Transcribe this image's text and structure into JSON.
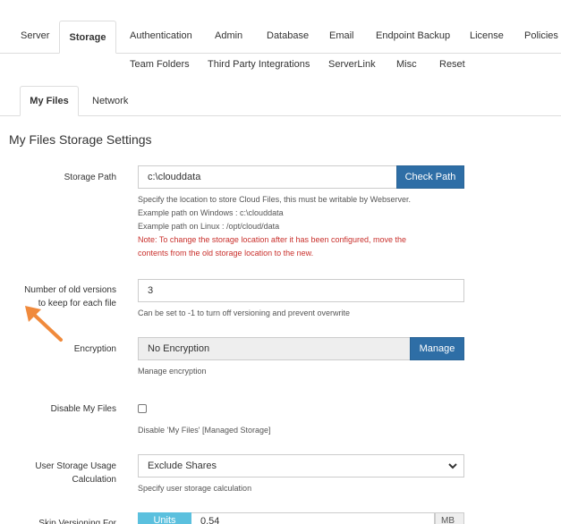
{
  "tabs_row1": [
    {
      "label": "Server"
    },
    {
      "label": "Storage"
    },
    {
      "label": "Authentication"
    },
    {
      "label": "Admin"
    },
    {
      "label": "Database"
    },
    {
      "label": "Email"
    },
    {
      "label": "Endpoint Backup"
    },
    {
      "label": "License"
    },
    {
      "label": "Policies"
    }
  ],
  "tabs_row2": [
    {
      "label": "Team Folders"
    },
    {
      "label": "Third Party Integrations"
    },
    {
      "label": "ServerLink"
    },
    {
      "label": "Misc"
    },
    {
      "label": "Reset"
    }
  ],
  "subtabs": [
    {
      "label": "My Files"
    },
    {
      "label": "Network"
    }
  ],
  "section_title": "My Files Storage Settings",
  "storage_path": {
    "label": "Storage Path",
    "value": "c:\\clouddata",
    "button": "Check Path",
    "help1": "Specify the location to store Cloud Files, this must be writable by Webserver.",
    "help2": "Example path on Windows : c:\\clouddata",
    "help3": "Example path on Linux : /opt/cloud/data",
    "note1": "Note: To change the storage location after it has been configured, move the",
    "note2": "contents from the old storage location to the new."
  },
  "old_versions": {
    "label1": "Number of old versions",
    "label2": "to keep for each file",
    "value": "3",
    "help": "Can be set to -1 to turn off versioning and prevent overwrite"
  },
  "encryption": {
    "label": "Encryption",
    "value": "No Encryption",
    "button": "Manage",
    "help": "Manage encryption"
  },
  "disable_my_files": {
    "label": "Disable My Files",
    "checked": false,
    "help": "Disable 'My Files' [Managed Storage]"
  },
  "user_storage_usage": {
    "label1": "User Storage Usage",
    "label2": "Calculation",
    "selected": "Exclude Shares",
    "help": "Specify user storage calculation"
  },
  "skip_versioning": {
    "label": "Skip Versioning For",
    "units_button": "Units",
    "value": "0.54",
    "unit": "MB"
  },
  "colors": {
    "primary_button": "#2e6ea6",
    "info_button": "#5bc0de",
    "note_red": "#c9302c",
    "arrow": "#f08a3c"
  }
}
